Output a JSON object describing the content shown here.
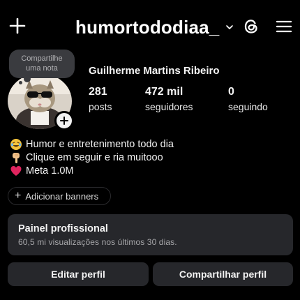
{
  "header": {
    "username": "humortododiaa_",
    "icons": [
      "plus-icon",
      "chevron-down-icon",
      "threads-icon",
      "menu-icon"
    ]
  },
  "note": {
    "text_line1": "Compartilhe",
    "text_line2": "uma nota"
  },
  "profile": {
    "full_name": "Guilherme Martins Ribeiro",
    "stats": [
      {
        "value": "281",
        "label": "posts"
      },
      {
        "value": "472 mil",
        "label": "seguidores"
      },
      {
        "value": "0",
        "label": "seguindo"
      }
    ]
  },
  "bio": {
    "lines": [
      {
        "emoji": "laughing-face",
        "text": "Humor e entretenimento todo dia"
      },
      {
        "emoji": "pointing-down-hand",
        "text": "Clique em seguir e ria muitooo"
      },
      {
        "emoji": "red-heart",
        "text": "Meta 1.0M"
      }
    ]
  },
  "banner_chip": {
    "label": "Adicionar banners"
  },
  "professional_panel": {
    "title": "Painel profissional",
    "subtitle": "60,5 mi visualizações nos últimos 30 dias."
  },
  "buttons": {
    "edit": "Editar perfil",
    "share": "Compartilhar perfil"
  },
  "colors": {
    "background": "#000000",
    "surface": "#26272b",
    "note_bubble": "#3a3b3f",
    "heart": "#e0245e",
    "laugh_emoji": "#f5c33b"
  }
}
